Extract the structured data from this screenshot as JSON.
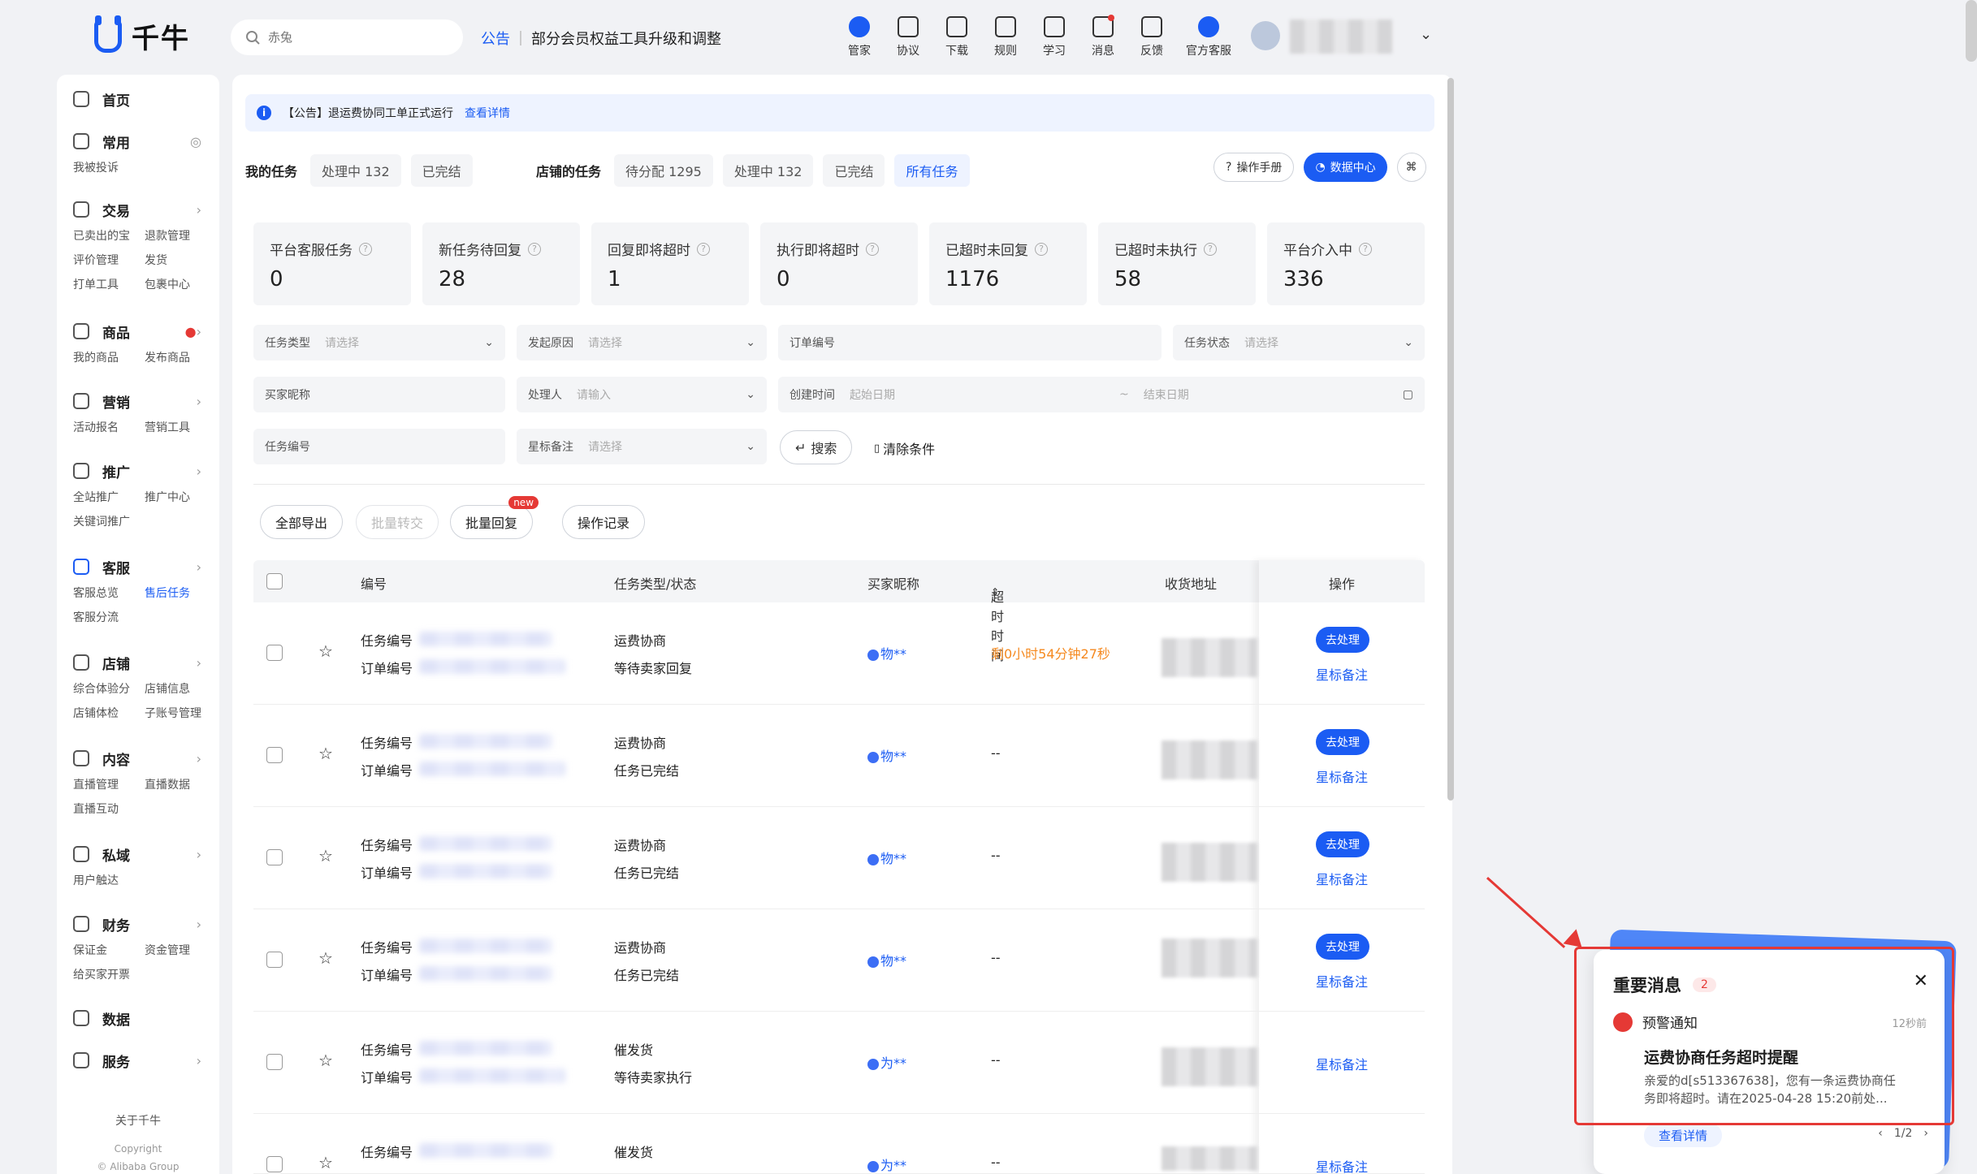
{
  "app": {
    "logo_text": "千牛"
  },
  "search": {
    "placeholder": "赤兔"
  },
  "top_notice": {
    "tag": "公告",
    "text": "部分会员权益工具升级和调整"
  },
  "tools": [
    {
      "icon": "butler-icon",
      "label": "管家"
    },
    {
      "icon": "agreement-icon",
      "label": "协议"
    },
    {
      "icon": "download-icon",
      "label": "下载"
    },
    {
      "icon": "rules-icon",
      "label": "规则"
    },
    {
      "icon": "learn-icon",
      "label": "学习"
    },
    {
      "icon": "message-icon",
      "label": "消息"
    },
    {
      "icon": "feedback-icon",
      "label": "反馈"
    },
    {
      "icon": "official-service-icon",
      "label": "官方客服"
    }
  ],
  "sidebar": {
    "home": "首页",
    "common": {
      "title": "常用",
      "items": [
        "我被投诉"
      ]
    },
    "trade": {
      "title": "交易",
      "items": [
        "已卖出的宝",
        "退款管理",
        "评价管理",
        "发货",
        "打单工具",
        "包裹中心"
      ]
    },
    "goods": {
      "title": "商品",
      "items": [
        "我的商品",
        "发布商品"
      ]
    },
    "marketing": {
      "title": "营销",
      "items": [
        "活动报名",
        "营销工具"
      ]
    },
    "promote": {
      "title": "推广",
      "items": [
        "全站推广",
        "推广中心",
        "关键词推广"
      ]
    },
    "service": {
      "title": "客服",
      "items": [
        "客服总览",
        "售后任务",
        "客服分流"
      ]
    },
    "shop": {
      "title": "店铺",
      "items": [
        "综合体验分",
        "店铺信息",
        "店铺体检",
        "子账号管理"
      ]
    },
    "content": {
      "title": "内容",
      "items": [
        "直播管理",
        "直播数据",
        "直播互动"
      ]
    },
    "private": {
      "title": "私域",
      "items": [
        "用户触达"
      ]
    },
    "finance": {
      "title": "财务",
      "items": [
        "保证金",
        "资金管理",
        "给买家开票"
      ]
    },
    "data": "数据",
    "services": "服务",
    "about": "关于千牛",
    "copyright": "Copyright",
    "copyright2": "© Alibaba Group"
  },
  "announcement": {
    "text": "【公告】退运费协同工单正式运行",
    "link": "查看详情"
  },
  "tabs": {
    "my_label": "我的任务",
    "my": [
      "处理中 132",
      "已完结"
    ],
    "shop_label": "店铺的任务",
    "shop": [
      "待分配 1295",
      "处理中 132",
      "已完结",
      "所有任务"
    ],
    "manual": "操作手册",
    "datacenter": "数据中心"
  },
  "stats": [
    {
      "label": "平台客服任务",
      "value": "0"
    },
    {
      "label": "新任务待回复",
      "value": "28"
    },
    {
      "label": "回复即将超时",
      "value": "1"
    },
    {
      "label": "执行即将超时",
      "value": "0"
    },
    {
      "label": "已超时未回复",
      "value": "1176"
    },
    {
      "label": "已超时未执行",
      "value": "58"
    },
    {
      "label": "平台介入中",
      "value": "336"
    }
  ],
  "filters": {
    "task_type": {
      "label": "任务类型",
      "ph": "请选择"
    },
    "reason": {
      "label": "发起原因",
      "ph": "请选择"
    },
    "order_no": {
      "label": "订单编号"
    },
    "task_status": {
      "label": "任务状态",
      "ph": "请选择"
    },
    "buyer": {
      "label": "买家昵称"
    },
    "handler": {
      "label": "处理人",
      "ph": "请输入"
    },
    "created": {
      "label": "创建时间",
      "start": "起始日期",
      "sep": "~",
      "end": "结束日期"
    },
    "task_no": {
      "label": "任务编号"
    },
    "star": {
      "label": "星标备注",
      "ph": "请选择"
    },
    "search_btn": "搜索",
    "clear_btn": "清除条件"
  },
  "actions": {
    "export": "全部导出",
    "transfer": "批量转交",
    "reply": "批量回复",
    "new_badge": "new",
    "log": "操作记录"
  },
  "table": {
    "headers": {
      "no": "编号",
      "type": "任务类型/状态",
      "buyer": "买家昵称",
      "timeout": "超时时间",
      "address": "收货地址",
      "op": "操作"
    },
    "task_label": "任务编号",
    "order_label": "订单编号",
    "go": "去处理",
    "star_note": "星标备注",
    "rows": [
      {
        "type": "运费协商",
        "status": "等待卖家回复",
        "buyer": "物**",
        "timeout": "剩0小时54分钟27秒"
      },
      {
        "type": "运费协商",
        "status": "任务已完结",
        "buyer": "物**",
        "timeout": "--"
      },
      {
        "type": "运费协商",
        "status": "任务已完结",
        "buyer": "物**",
        "timeout": "--"
      },
      {
        "type": "运费协商",
        "status": "任务已完结",
        "buyer": "物**",
        "timeout": "--"
      },
      {
        "type": "催发货",
        "status": "等待卖家执行",
        "buyer": "为**",
        "timeout": "--"
      },
      {
        "type": "催发货",
        "status": "",
        "buyer": "为**",
        "timeout": "--"
      }
    ]
  },
  "popup": {
    "title": "重要消息",
    "count": "2",
    "kind": "预警通知",
    "time": "12秒前",
    "headline": "运费协商任务超时提醒",
    "body1": "亲爱的d[s513367638]，您有一条运费协商任",
    "body2": "务即将超时。请在2025-04-28 15:20前处...",
    "link": "查看详情",
    "page": "1/2"
  }
}
